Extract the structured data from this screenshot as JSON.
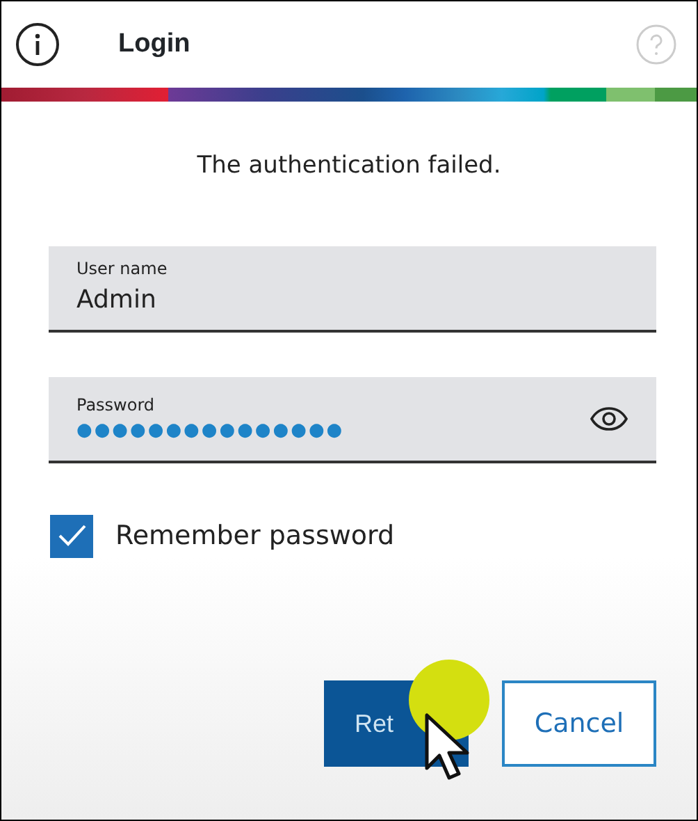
{
  "window": {
    "title": "Login"
  },
  "message": "The authentication failed.",
  "fields": [
    {
      "label": "User name",
      "value": "Admin",
      "kind": "text"
    },
    {
      "label": "Password",
      "value": "●●●●●●●●●●●●●●●",
      "kind": "password"
    }
  ],
  "remember": {
    "label": "Remember password",
    "checked": true
  },
  "buttons": [
    {
      "label": "Ret",
      "kind": "primary"
    },
    {
      "label": "Cancel",
      "kind": "outline"
    }
  ]
}
